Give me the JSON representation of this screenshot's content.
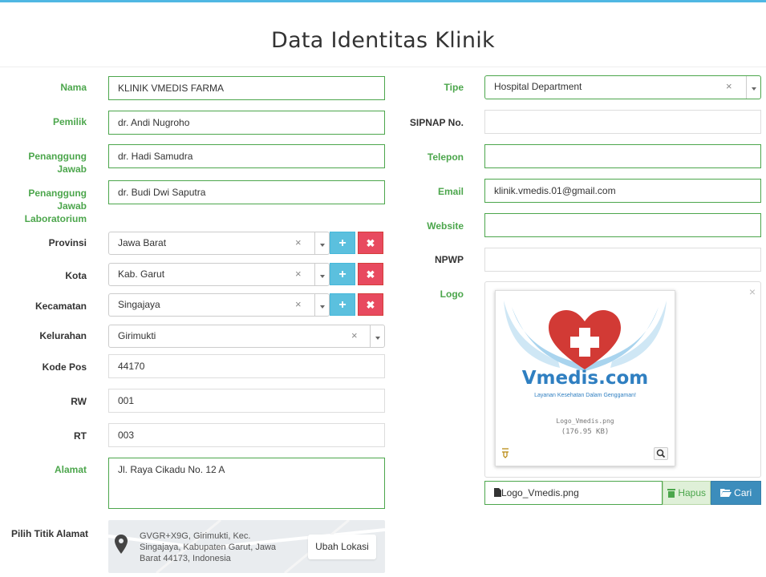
{
  "page": {
    "title": "Data Identitas Klinik"
  },
  "labels": {
    "nama": "Nama",
    "pemilik": "Pemilik",
    "pj": "Penanggung Jawab",
    "pjl": "Penanggung Jawab Laboratorium",
    "provinsi": "Provinsi",
    "kota": "Kota",
    "kecamatan": "Kecamatan",
    "kelurahan": "Kelurahan",
    "kode_pos": "Kode Pos",
    "rw": "RW",
    "rt": "RT",
    "alamat": "Alamat",
    "titik": "Pilih Titik Alamat",
    "tipe": "Tipe",
    "sipnap": "SIPNAP No.",
    "telepon": "Telepon",
    "email": "Email",
    "website": "Website",
    "npwp": "NPWP",
    "logo": "Logo"
  },
  "values": {
    "nama": "KLINIK VMEDIS FARMA",
    "pemilik": "dr. Andi Nugroho",
    "pj": "dr. Hadi Samudra",
    "pjl": "dr. Budi Dwi Saputra",
    "provinsi": "Jawa Barat",
    "kota": "Kab. Garut",
    "kecamatan": "Singajaya",
    "kelurahan": "Girimukti",
    "kode_pos": "44170",
    "rw": "001",
    "rt": "003",
    "alamat": "Jl. Raya Cikadu No. 12 A",
    "tipe": "Hospital Department",
    "sipnap": "",
    "telepon": "",
    "email": "klinik.vmedis.01@gmail.com",
    "website": "",
    "npwp": ""
  },
  "map": {
    "address": "GVGR+X9G, Girimukti, Kec. Singajaya, Kabupaten Garut, Jawa Barat 44173, Indonesia",
    "button": "Ubah Lokasi"
  },
  "logo": {
    "brand": "Vmedis.com",
    "tagline": "Layanan Kesehatan Dalam Genggaman!",
    "file_name": "Logo_Vmedis.png",
    "file_size": "(176.95 KB)",
    "hapus_label": "Hapus",
    "cari_label": "Cari"
  },
  "icons": {
    "clear": "×",
    "add": "+",
    "remove": "✖",
    "close": "×"
  },
  "colors": {
    "accent_green": "#4ca64c",
    "info_blue": "#5bc0de",
    "danger_red": "#e84a5f",
    "primary_blue": "#3c8dbc",
    "top_border": "#4fb7e3"
  }
}
